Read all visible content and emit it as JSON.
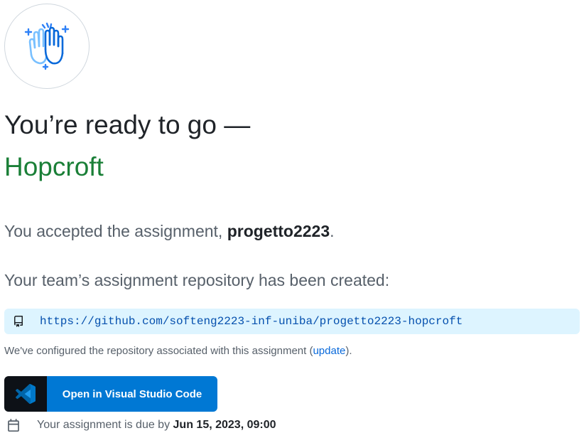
{
  "hero": {
    "icon": "high-five-icon",
    "title": "You’re ready to go —",
    "team_name": "Hopcroft"
  },
  "accepted": {
    "prefix": "You accepted the assignment, ",
    "assignment_name": "progetto2223",
    "suffix": "."
  },
  "repository": {
    "created_text": "Your team’s assignment repository has been created:",
    "icon": "repo-icon",
    "url": "https://github.com/softeng2223-inf-uniba/progetto2223-hopcroft"
  },
  "configured": {
    "prefix": "We've configured the repository associated with this assignment (",
    "link_label": "update",
    "suffix": ")."
  },
  "vscode_button": {
    "icon": "vscode-icon",
    "label": "Open in Visual Studio Code"
  },
  "due": {
    "icon": "calendar-icon",
    "prefix": "Your assignment is due by ",
    "date": "Jun 15, 2023, 09:00"
  },
  "colors": {
    "accent_green": "#1a7f37",
    "link_blue": "#0969da",
    "repo_bg": "#ddf4ff",
    "vscode_blue": "#0078d4"
  }
}
